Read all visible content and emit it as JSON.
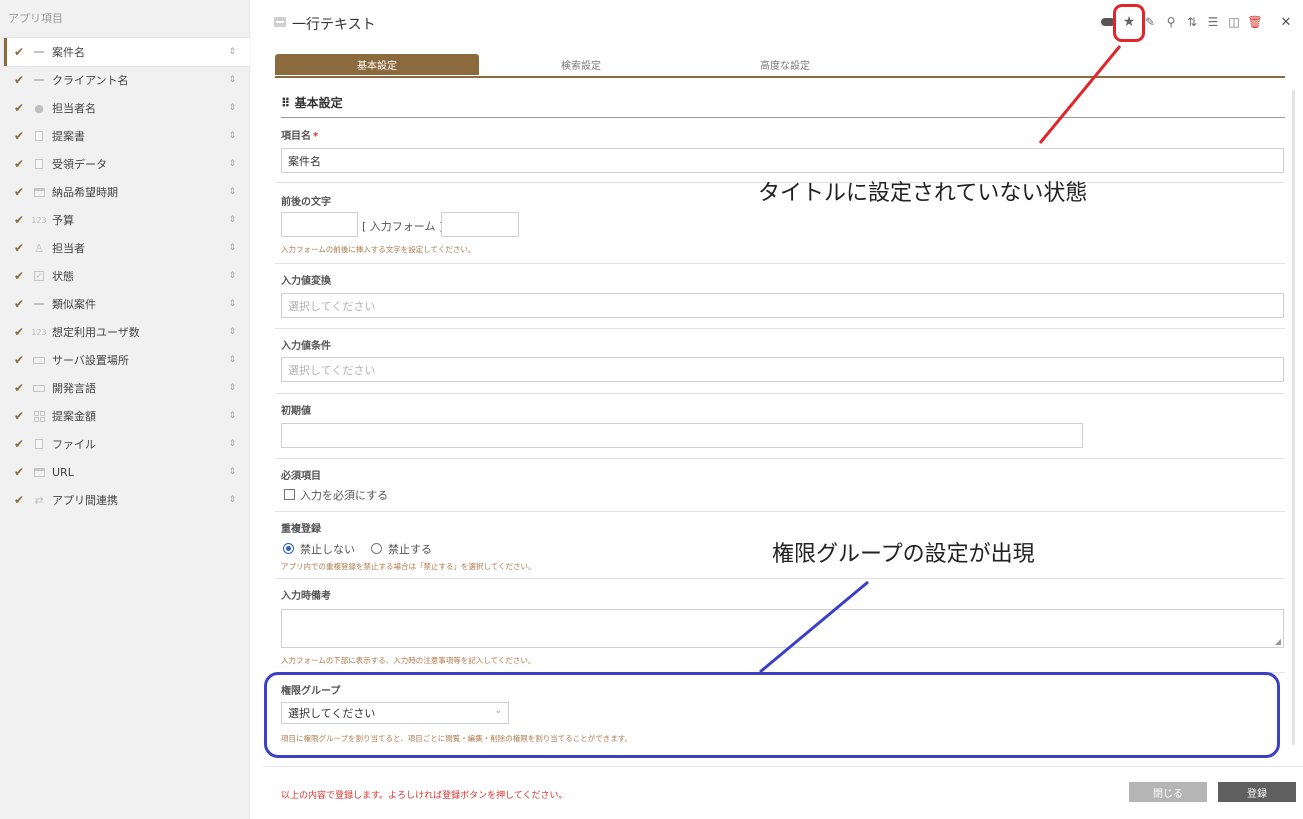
{
  "sidebar": {
    "title": "アプリ項目",
    "items": [
      {
        "label": "案件名",
        "icon": "text-line-icon",
        "active": true
      },
      {
        "label": "クライアント名",
        "icon": "text-line-icon"
      },
      {
        "label": "担当者名",
        "icon": "person-icon"
      },
      {
        "label": "提案書",
        "icon": "document-icon"
      },
      {
        "label": "受領データ",
        "icon": "document-icon"
      },
      {
        "label": "納品希望時期",
        "icon": "calendar-icon"
      },
      {
        "label": "予算",
        "icon": "number-icon",
        "icon_text": "123"
      },
      {
        "label": "担当者",
        "icon": "user-icon"
      },
      {
        "label": "状態",
        "icon": "checkbox-icon"
      },
      {
        "label": "類似案件",
        "icon": "text-line-icon"
      },
      {
        "label": "想定利用ユーザ数",
        "icon": "number-icon",
        "icon_text": "123"
      },
      {
        "label": "サーバ設置場所",
        "icon": "select-icon"
      },
      {
        "label": "開発言語",
        "icon": "select-icon"
      },
      {
        "label": "提案金額",
        "icon": "grid-icon"
      },
      {
        "label": "ファイル",
        "icon": "document-icon"
      },
      {
        "label": "URL",
        "icon": "link-icon"
      },
      {
        "label": "アプリ間連携",
        "icon": "swap-icon"
      }
    ]
  },
  "header": {
    "title": "一行テキスト",
    "toolbar": [
      "toggle-icon",
      "star-icon",
      "edit-icon",
      "search-icon",
      "sort-icon",
      "list-icon",
      "columns-icon",
      "trash-icon",
      "close-icon"
    ]
  },
  "tabs": [
    {
      "label": "基本設定",
      "active": true
    },
    {
      "label": "検索設定",
      "active": false
    },
    {
      "label": "高度な設定",
      "active": false
    }
  ],
  "form": {
    "section_title": "基本設定",
    "item_name": {
      "label": "項目名",
      "required_mark": "*",
      "value": "案件名"
    },
    "affix": {
      "label": "前後の文字",
      "middle": "[ 入力フォーム ]",
      "hint": "入力フォームの前後に挿入する文字を設定してください。"
    },
    "conversion": {
      "label": "入力値変換",
      "placeholder": "選択してください"
    },
    "condition": {
      "label": "入力値条件",
      "placeholder": "選択してください"
    },
    "initial": {
      "label": "初期値",
      "value": ""
    },
    "required": {
      "label": "必須項目",
      "checkbox_label": "入力を必須にする",
      "checked": false
    },
    "duplicate": {
      "label": "重複登録",
      "options": [
        "禁止しない",
        "禁止する"
      ],
      "selected": "禁止しない",
      "hint": "アプリ内での重複登録を禁止する場合は「禁止する」を選択してください。"
    },
    "note": {
      "label": "入力時備考",
      "hint": "入力フォームの下部に表示する、入力時の注意事項等を記入してください。"
    },
    "permission": {
      "label": "権限グループ",
      "selected": "選択してください",
      "hint": "項目に権限グループを割り当てると、項目ごとに閲覧・編集・削除の権限を割り当てることができます。"
    }
  },
  "footer": {
    "message": "以上の内容で登録します。よろしければ登録ボタンを押してください。",
    "close_label": "閉じる",
    "save_label": "登録"
  },
  "annotations": {
    "top_text": "タイトルに設定されていない状態",
    "bottom_text": "権限グループの設定が出現",
    "red_color": "#e0262b",
    "blue_color": "#3b40c6"
  },
  "colors": {
    "accent": "#8b6a3e",
    "required": "#d9352f",
    "hint": "#b07a4a"
  }
}
